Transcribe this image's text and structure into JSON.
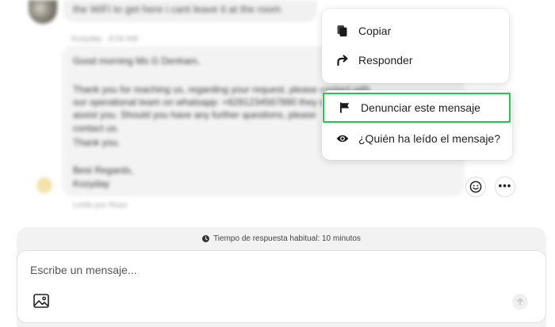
{
  "conversation": {
    "previous_message": "the WiFi to get here i cant leave it at the room",
    "sender_line": "Kozyday · 8:04 AM",
    "message_lines": [
      "Good morning Ms G Denham,",
      "",
      "Thank you for reaching us, regarding your request, please contact with",
      "our operational team on whatsapp: +6281234567890 they will",
      "assist you. Should you have any further questions, please",
      "contact us.",
      "Thank you.",
      "",
      "Best Regards,",
      "Kozyday"
    ],
    "read_status": "Leído por Rose"
  },
  "menu_primary": {
    "items": [
      {
        "label": "Copiar",
        "icon": "copy-icon"
      },
      {
        "label": "Responder",
        "icon": "reply-arrow-icon"
      }
    ]
  },
  "menu_secondary": {
    "items": [
      {
        "label": "Denunciar este mensaje",
        "icon": "flag-icon",
        "highlighted": true
      },
      {
        "label": "¿Quién ha leído el mensaje?",
        "icon": "eye-icon"
      }
    ]
  },
  "actions": {
    "reaction_icon": "smiley-icon",
    "more_icon": "more-horizontal-icon",
    "more_glyph": "•••"
  },
  "composer": {
    "response_time": "Tiempo de respuesta habitual: 10 minutos",
    "placeholder": "Escribe un mensaje...",
    "photo_icon": "image-icon",
    "send_icon": "arrow-up-icon"
  },
  "colors": {
    "highlight_border": "#22c84a",
    "composer_area_background": "#f2f2f2",
    "bubble_background": "#f3f3f3"
  }
}
